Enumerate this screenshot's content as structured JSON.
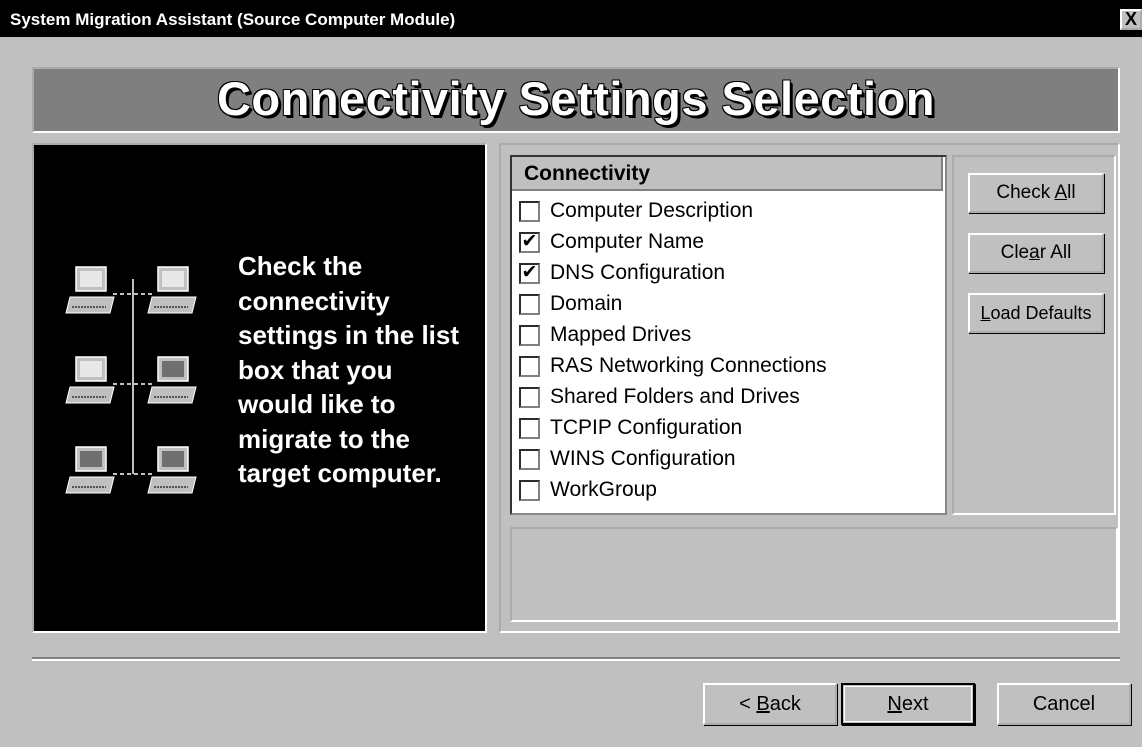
{
  "window": {
    "title": "System Migration Assistant (Source Computer Module)",
    "close_label": "X"
  },
  "banner": {
    "title": "Connectivity Settings Selection"
  },
  "instructions": {
    "text": "Check the connectivity settings in the list box that you would like to migrate to the target computer."
  },
  "list": {
    "header": "Connectivity",
    "items": [
      {
        "label": "Computer Description",
        "checked": false,
        "mark": ""
      },
      {
        "label": "Computer Name",
        "checked": true,
        "mark": "✔"
      },
      {
        "label": "DNS Configuration",
        "checked": true,
        "mark": "✔"
      },
      {
        "label": "Domain",
        "checked": false,
        "mark": ""
      },
      {
        "label": "Mapped Drives",
        "checked": false,
        "mark": ""
      },
      {
        "label": "RAS Networking Connections",
        "checked": false,
        "mark": ""
      },
      {
        "label": "Shared Folders and Drives",
        "checked": false,
        "mark": ""
      },
      {
        "label": "TCPIP Configuration",
        "checked": false,
        "mark": ""
      },
      {
        "label": "WINS Configuration",
        "checked": false,
        "mark": ""
      },
      {
        "label": "WorkGroup",
        "checked": false,
        "mark": ""
      }
    ]
  },
  "buttons": {
    "check_all": {
      "pre": "Check ",
      "accel": "A",
      "post": "ll"
    },
    "clear_all": {
      "pre": "Cle",
      "accel": "a",
      "post": "r All"
    },
    "load_defaults": {
      "pre": "",
      "accel": "L",
      "post": "oad Defaults"
    }
  },
  "nav": {
    "back": {
      "pre": "< ",
      "accel": "B",
      "post": "ack"
    },
    "next": {
      "pre": "",
      "accel": "N",
      "post": "ext"
    },
    "cancel": "Cancel"
  },
  "colors": {
    "titlebar": "#000000",
    "face": "#c0c0c0",
    "banner": "#7f7f7f",
    "panel": "#000000"
  }
}
